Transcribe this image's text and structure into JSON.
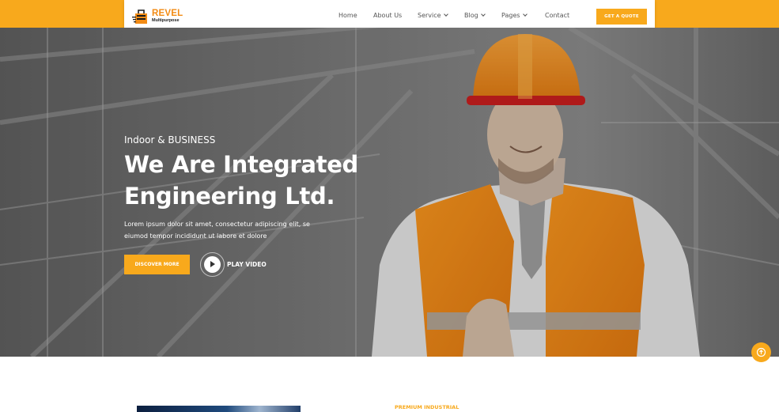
{
  "brand": {
    "name": "REVEL",
    "tagline": "Multipurpose"
  },
  "nav": {
    "items": [
      {
        "label": "Home",
        "has_dropdown": false
      },
      {
        "label": "About Us",
        "has_dropdown": false
      },
      {
        "label": "Service",
        "has_dropdown": true
      },
      {
        "label": "Blog",
        "has_dropdown": true
      },
      {
        "label": "Pages",
        "has_dropdown": true
      },
      {
        "label": "Contact",
        "has_dropdown": false
      }
    ],
    "cta": "GET A QUOTE"
  },
  "hero": {
    "kicker": "Indoor & BUSINESS",
    "title_line1": "We Are Integrated",
    "title_line2": "Engineering Ltd.",
    "text_line1": "Lorem ipsum dolor sit amet, consectetur adipiscing elit, se",
    "text_line2": "eiumod tempor incididunt ut labore et dolore",
    "primary_button": "DISCOVER MORE",
    "video_button": "PLAY VIDEO"
  },
  "section": {
    "eyebrow": "PREMIUM INDUSTRIAL"
  },
  "colors": {
    "accent": "#f8a91c",
    "logo": "#f28b14",
    "dark": "#1b1b1b"
  },
  "icons": {
    "play": "play-icon",
    "scroll_top": "arrow-up-icon",
    "logo": "logo-mark-icon"
  }
}
